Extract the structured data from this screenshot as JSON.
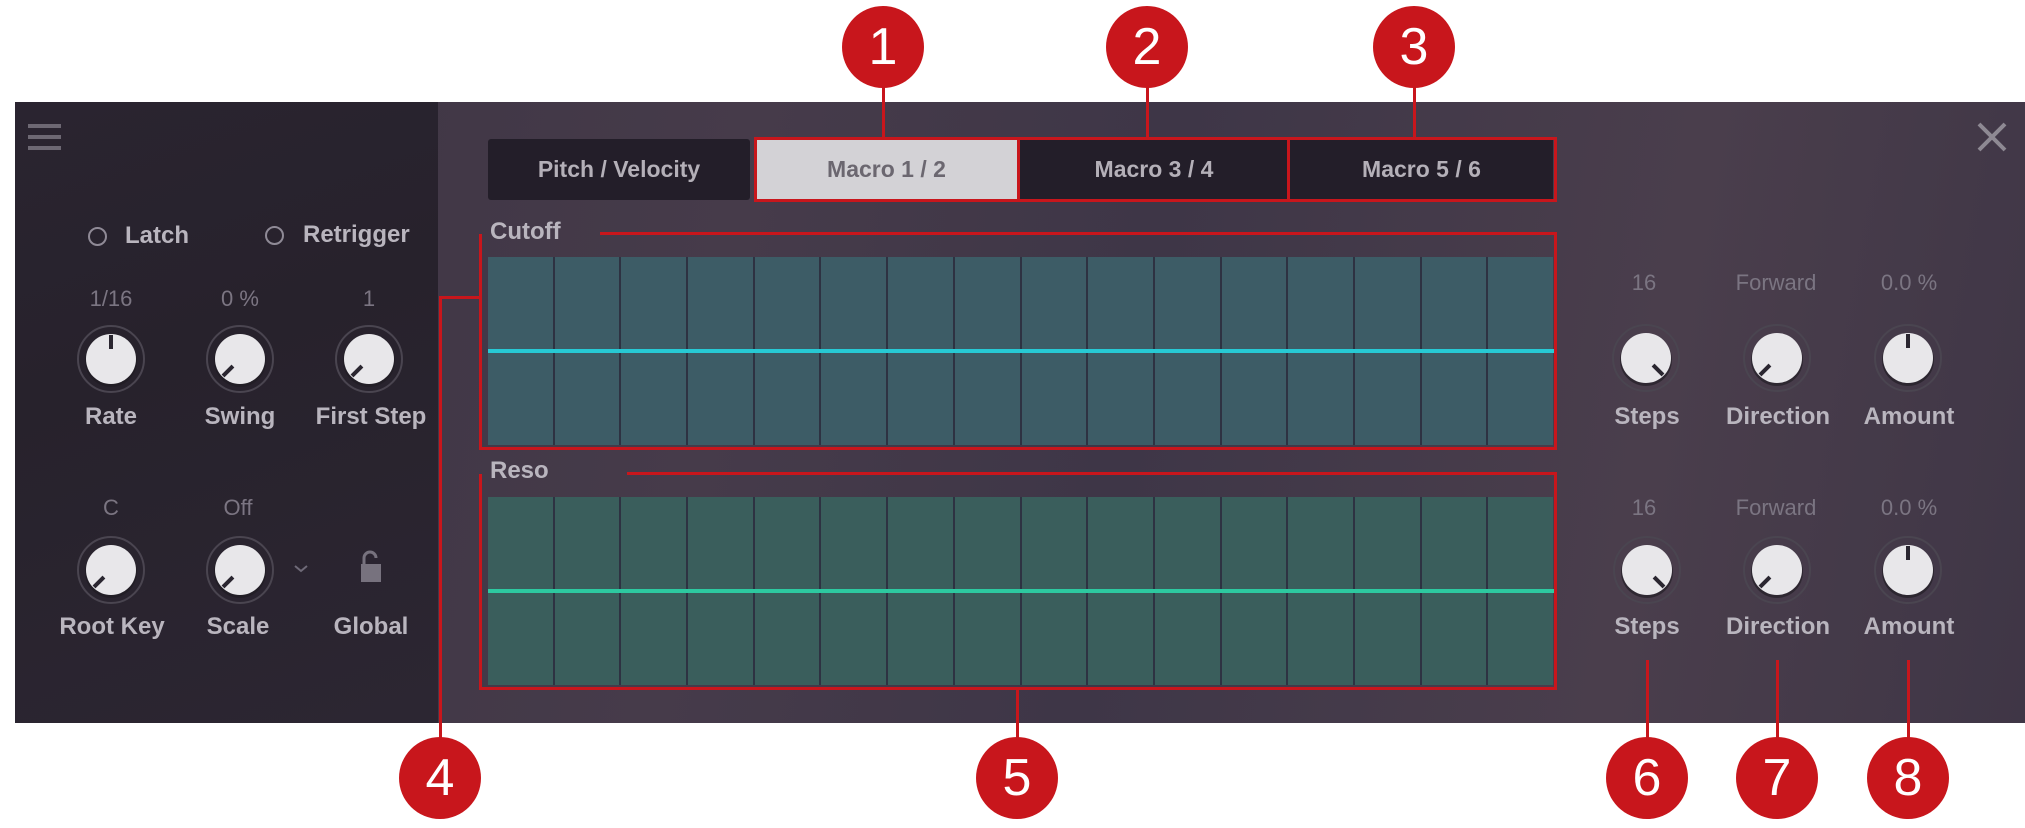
{
  "window": {
    "menu_icon": "hamburger-icon",
    "close_icon": "close-icon"
  },
  "sidebar": {
    "toggles": [
      {
        "label": "Latch",
        "checked": false
      },
      {
        "label": "Retrigger",
        "checked": false
      }
    ],
    "knobs_row1": [
      {
        "label": "Rate",
        "value": "1/16",
        "position": 0.5
      },
      {
        "label": "Swing",
        "value": "0 %",
        "position": 0.0
      },
      {
        "label": "First Step",
        "value": "1",
        "position": 0.0
      }
    ],
    "knobs_row2": [
      {
        "label": "Root Key",
        "value": "C",
        "position": 0.0
      },
      {
        "label": "Scale",
        "value": "Off",
        "position": 0.0
      }
    ],
    "global": {
      "label": "Global",
      "icon": "unlock-icon",
      "locked": false
    },
    "scale_dropdown_icon": "chevron-down-icon"
  },
  "tabs": [
    {
      "label": "Pitch / Velocity",
      "active": false
    },
    {
      "label": "Macro 1 / 2",
      "active": true
    },
    {
      "label": "Macro 3 / 4",
      "active": false
    },
    {
      "label": "Macro 5 / 6",
      "active": false
    }
  ],
  "lanes": [
    {
      "name": "Cutoff",
      "steps": 16,
      "step_values": [
        0.5,
        0.5,
        0.5,
        0.5,
        0.5,
        0.5,
        0.5,
        0.5,
        0.5,
        0.5,
        0.5,
        0.5,
        0.5,
        0.5,
        0.5,
        0.5
      ],
      "cell_color": "#3d5c66",
      "line_color": "#27c9d4",
      "controls": [
        {
          "label": "Steps",
          "value": "16",
          "position": 1.0
        },
        {
          "label": "Direction",
          "value": "Forward",
          "position": 0.0
        },
        {
          "label": "Amount",
          "value": "0.0 %",
          "position": 0.5
        }
      ]
    },
    {
      "name": "Reso",
      "steps": 16,
      "step_values": [
        0.5,
        0.5,
        0.5,
        0.5,
        0.5,
        0.5,
        0.5,
        0.5,
        0.5,
        0.5,
        0.5,
        0.5,
        0.5,
        0.5,
        0.5,
        0.5
      ],
      "cell_color": "#3a5e5c",
      "line_color": "#2dc9a0",
      "controls": [
        {
          "label": "Steps",
          "value": "16",
          "position": 1.0
        },
        {
          "label": "Direction",
          "value": "Forward",
          "position": 0.0
        },
        {
          "label": "Amount",
          "value": "0.0 %",
          "position": 0.5
        }
      ]
    }
  ],
  "callouts": [
    "1",
    "2",
    "3",
    "4",
    "5",
    "6",
    "7",
    "8"
  ],
  "colors": {
    "annotation_red": "#c8161c",
    "knob_face": "#e8e7ea"
  }
}
